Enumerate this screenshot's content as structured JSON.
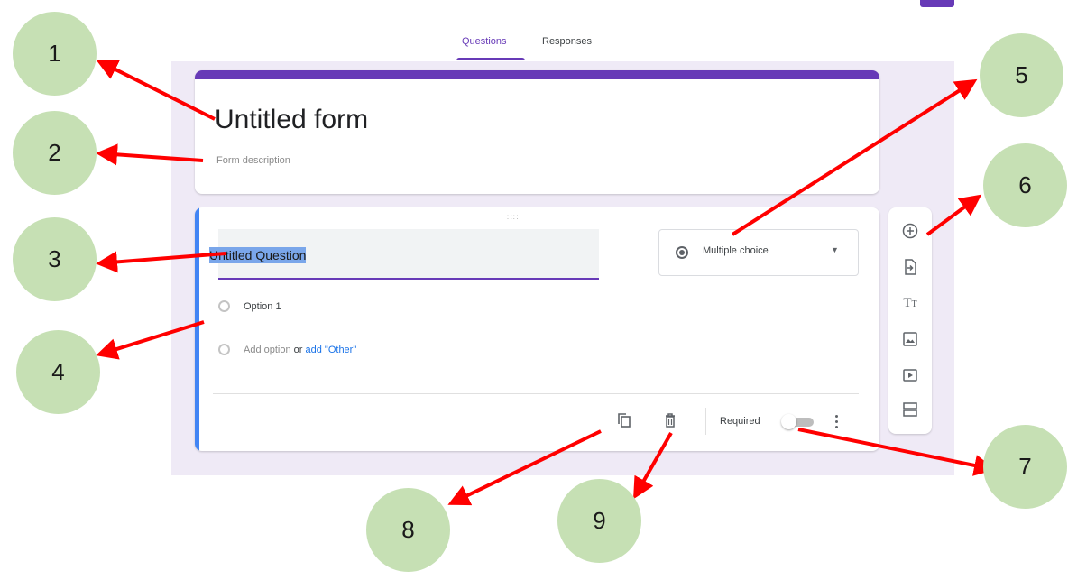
{
  "tabs": [
    {
      "label": "Questions",
      "active": true
    },
    {
      "label": "Responses",
      "active": false
    }
  ],
  "form": {
    "title": "Untitled form",
    "description_placeholder": "Form description"
  },
  "question": {
    "title": "Untitled Question",
    "type_selected": "Multiple choice",
    "options": [
      "Option 1"
    ],
    "add_option_label": "Add option",
    "or_label": "or",
    "add_other_label": "add \"Other\"",
    "required_label": "Required",
    "required": false
  },
  "footer_icons": [
    "duplicate-icon",
    "delete-icon",
    "more-options-icon"
  ],
  "toolbar": [
    "add-question-icon",
    "import-questions-icon",
    "add-title-description-icon",
    "add-image-icon",
    "add-video-icon",
    "add-section-icon"
  ],
  "callouts": [
    "1",
    "2",
    "3",
    "4",
    "5",
    "6",
    "7",
    "8",
    "9"
  ],
  "colors": {
    "accent": "#673ab7",
    "question_accent": "#4285f4",
    "link": "#1a73e8",
    "callout_fill": "#c6e0b4",
    "arrow": "#ff0000"
  }
}
